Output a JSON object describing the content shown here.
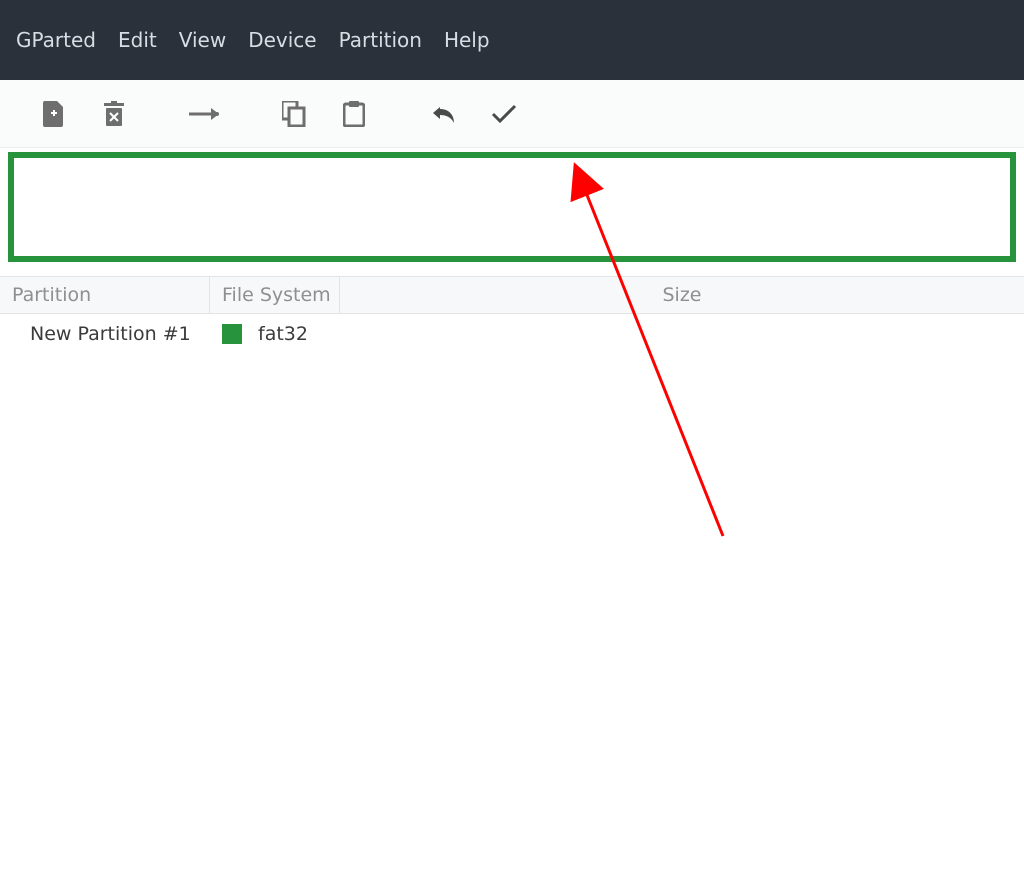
{
  "menu": {
    "gparted": "GParted",
    "edit": "Edit",
    "view": "View",
    "device": "Device",
    "partition": "Partition",
    "help": "Help"
  },
  "toolbar": {
    "new": "new-partition",
    "delete": "delete-partition",
    "resize": "resize-move",
    "copy": "copy",
    "paste": "paste",
    "undo": "undo",
    "apply": "apply"
  },
  "columns": {
    "partition": "Partition",
    "filesystem": "File System",
    "size": "Size"
  },
  "rows": [
    {
      "partition": "New Partition #1",
      "fs_label": "fat32",
      "fs_color": "#27933c"
    }
  ],
  "colors": {
    "fat32": "#27933c"
  }
}
